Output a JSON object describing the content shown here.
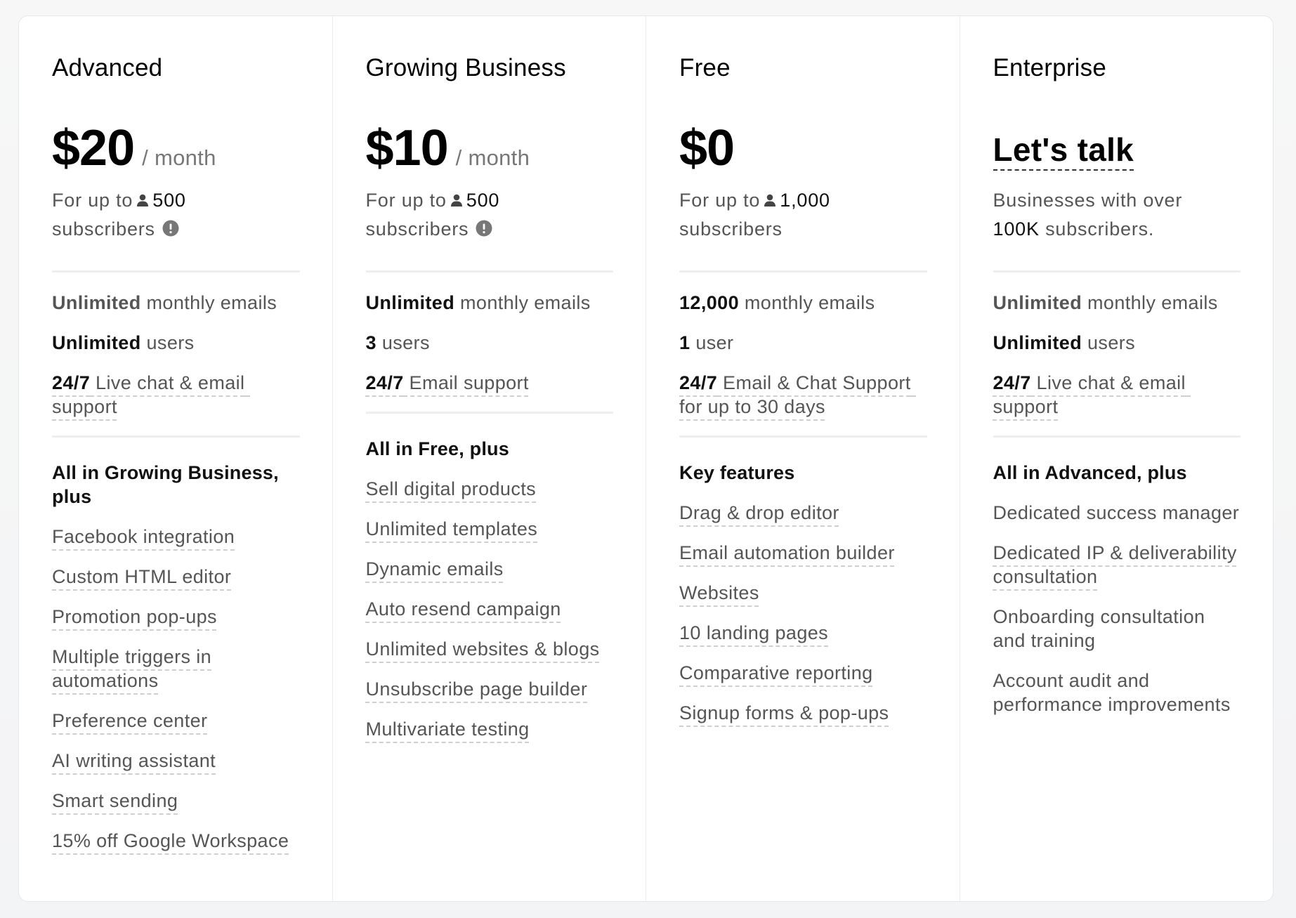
{
  "plans": [
    {
      "name": "Advanced",
      "price": "$20",
      "period": "/ month",
      "subtitle_prefix": "For up to",
      "subscribers": "500",
      "subtitle_suffix": "subscribers",
      "has_info_icon": true,
      "limits": [
        {
          "bold": "Unlimited",
          "text": " monthly emails",
          "dashed": false,
          "muted": true
        },
        {
          "bold": "Unlimited",
          "text": " users",
          "dashed": false,
          "muted": false
        },
        {
          "bold": "24/7",
          "text": " Live chat & email support",
          "dashed": true,
          "muted": false
        }
      ],
      "features_heading": "All in Growing Business, plus",
      "features": [
        {
          "label": "Facebook integration",
          "dashed": true
        },
        {
          "label": "Custom HTML editor",
          "dashed": true
        },
        {
          "label": "Promotion pop-ups",
          "dashed": true
        },
        {
          "label": "Multiple triggers in automations",
          "dashed": true
        },
        {
          "label": "Preference center",
          "dashed": true
        },
        {
          "label": "AI writing assistant",
          "dashed": true
        },
        {
          "label": "Smart sending",
          "dashed": true
        },
        {
          "label": "15% off Google Workspace",
          "dashed": true
        }
      ]
    },
    {
      "name": "Growing Business",
      "price": "$10",
      "period": "/ month",
      "subtitle_prefix": "For up to",
      "subscribers": "500",
      "subtitle_suffix": "subscribers",
      "has_info_icon": true,
      "limits": [
        {
          "bold": "Unlimited",
          "text": " monthly emails",
          "dashed": false,
          "muted": false
        },
        {
          "bold": "3",
          "text": " users",
          "dashed": false,
          "muted": false
        },
        {
          "bold": "24/7",
          "text": " Email support",
          "dashed": true,
          "muted": false
        }
      ],
      "features_heading": "All in Free, plus",
      "features": [
        {
          "label": "Sell digital products",
          "dashed": true
        },
        {
          "label": "Unlimited templates",
          "dashed": true
        },
        {
          "label": "Dynamic emails",
          "dashed": true
        },
        {
          "label": "Auto resend campaign",
          "dashed": true
        },
        {
          "label": "Unlimited websites & blogs",
          "dashed": true
        },
        {
          "label": "Unsubscribe page builder",
          "dashed": true
        },
        {
          "label": "Multivariate testing",
          "dashed": true
        }
      ]
    },
    {
      "name": "Free",
      "price": "$0",
      "period": "",
      "subtitle_prefix": "For up to",
      "subscribers": "1,000",
      "subtitle_suffix": "subscribers",
      "has_info_icon": false,
      "limits": [
        {
          "bold": "12,000",
          "text": " monthly emails",
          "dashed": false,
          "muted": false
        },
        {
          "bold": "1",
          "text": " user",
          "dashed": false,
          "muted": false
        },
        {
          "bold": "24/7",
          "text": " Email & Chat Support for up to 30 days",
          "dashed": true,
          "muted": false
        }
      ],
      "features_heading": "Key features",
      "features": [
        {
          "label": "Drag & drop editor",
          "dashed": true
        },
        {
          "label": "Email automation builder",
          "dashed": true
        },
        {
          "label": "Websites",
          "dashed": true
        },
        {
          "label": "10 landing pages",
          "dashed": true
        },
        {
          "label": "Comparative reporting",
          "dashed": true
        },
        {
          "label": "Signup forms & pop-ups",
          "dashed": true
        }
      ]
    },
    {
      "name": "Enterprise",
      "price": "Let's talk",
      "period": "",
      "subtitle_prefix": "Businesses with over",
      "subscribers": "100K",
      "subtitle_suffix": "subscribers.",
      "has_info_icon": false,
      "limits": [
        {
          "bold": "Unlimited",
          "text": " monthly emails",
          "dashed": false,
          "muted": true
        },
        {
          "bold": "Unlimited",
          "text": " users",
          "dashed": false,
          "muted": false
        },
        {
          "bold": "24/7",
          "text": " Live chat & email support",
          "dashed": true,
          "muted": false
        }
      ],
      "features_heading": "All in Advanced, plus",
      "features": [
        {
          "label": "Dedicated success manager",
          "dashed": false
        },
        {
          "label": "Dedicated IP & deliverability consultation",
          "dashed": true
        },
        {
          "label": "Onboarding consultation and training",
          "dashed": false
        },
        {
          "label": "Account audit and performance improvements",
          "dashed": false
        }
      ]
    }
  ],
  "icons": {
    "subscriber": "user-icon",
    "info": "info-exclamation-icon"
  },
  "colors": {
    "text_primary": "#111111",
    "text_secondary": "#555555",
    "period": "#777777",
    "divider": "#eeeeee",
    "background": "#f3f4f6"
  }
}
